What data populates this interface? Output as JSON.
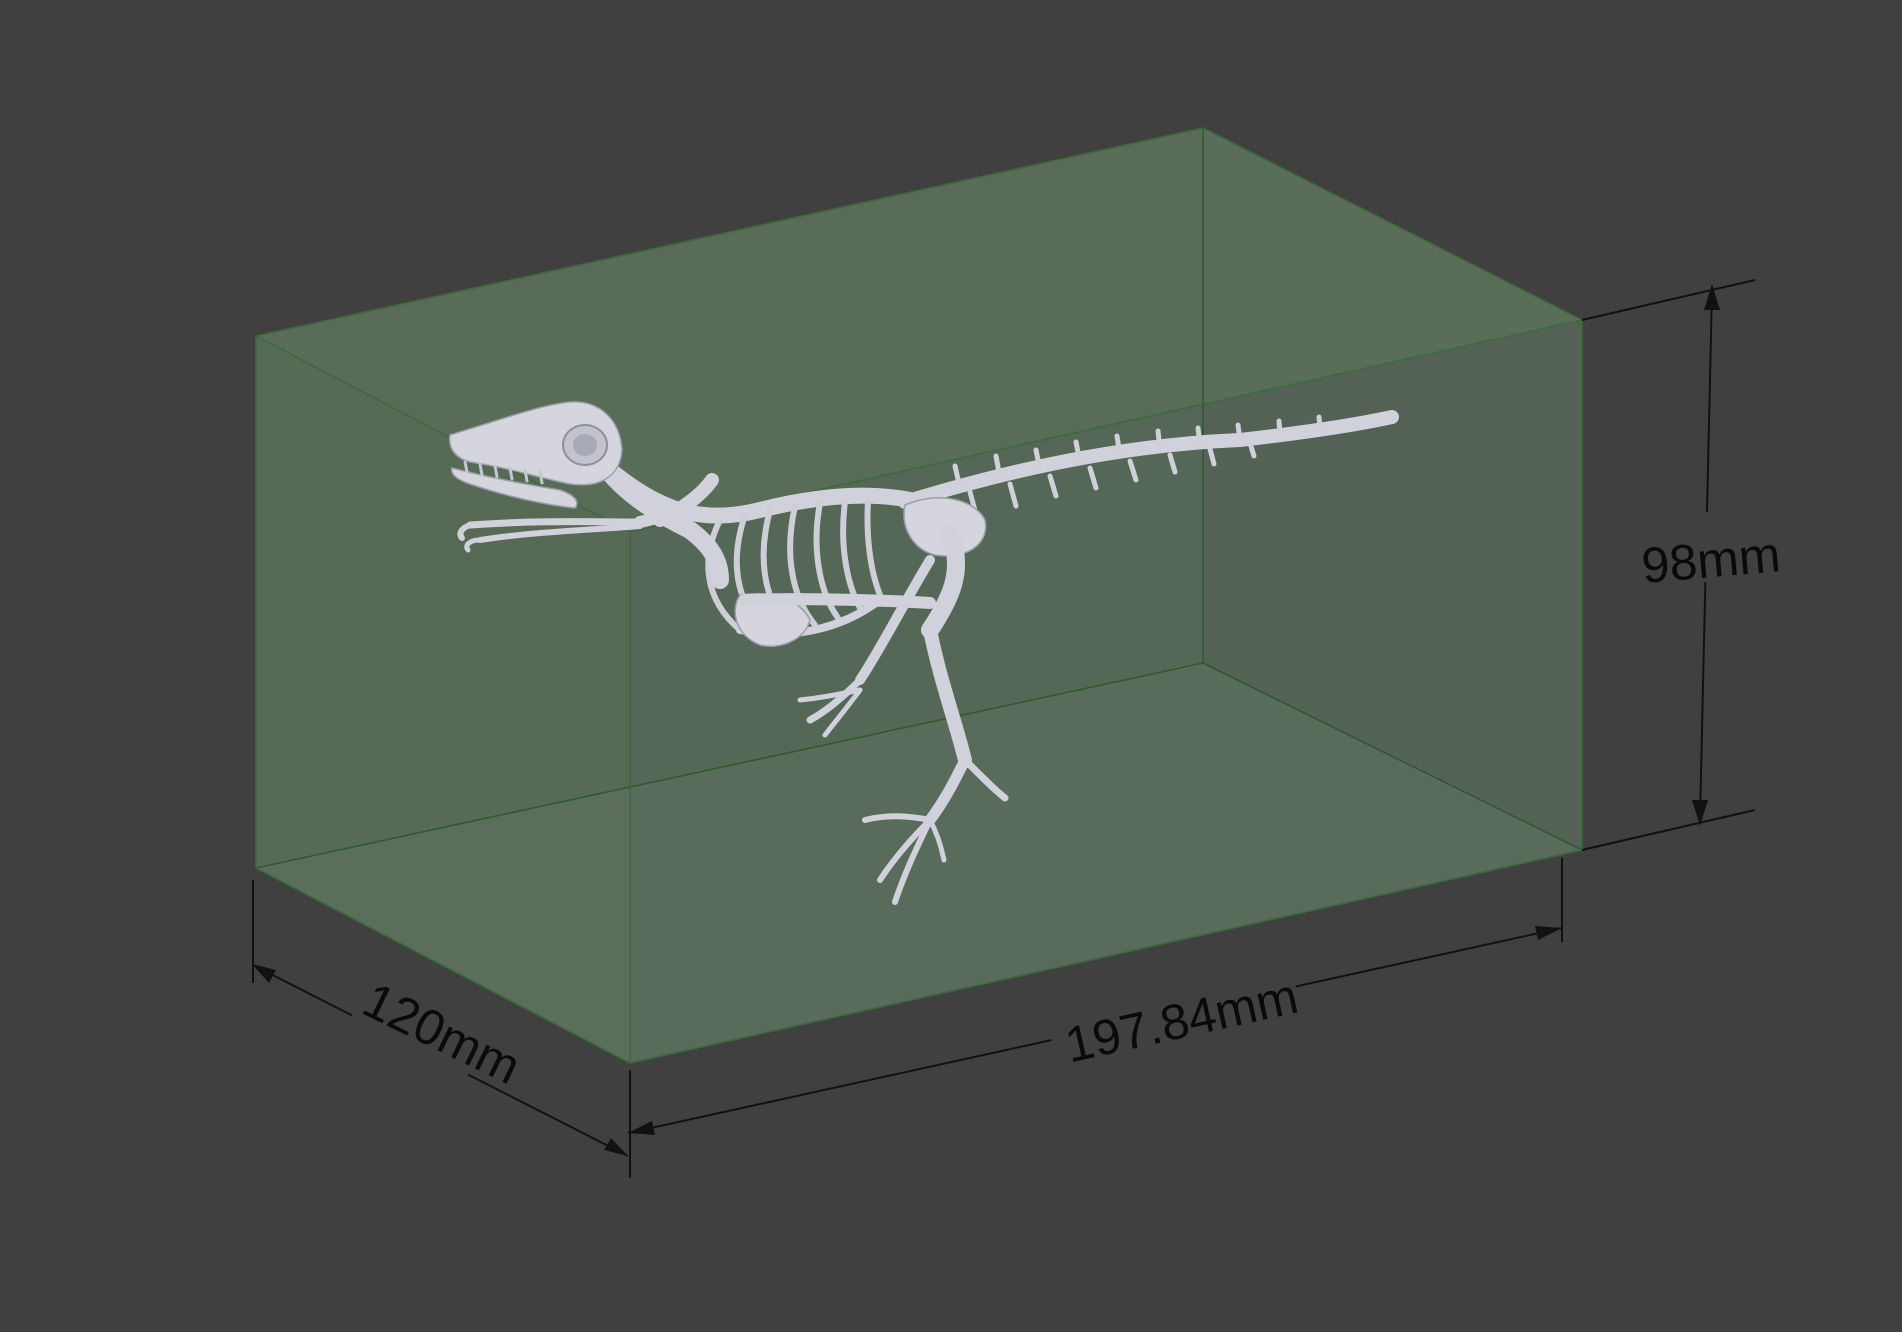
{
  "colors": {
    "background": "#404040",
    "box_fill": "#5a6f5a",
    "box_edge": "#2f5a2f",
    "bone": "#d4d5dd",
    "dimension_line": "#111111"
  },
  "dimensions": {
    "height_label": "98mm",
    "depth_label": "120mm",
    "width_label": "197.84mm"
  },
  "model": {
    "icon": "dinosaur-skeleton-icon"
  }
}
